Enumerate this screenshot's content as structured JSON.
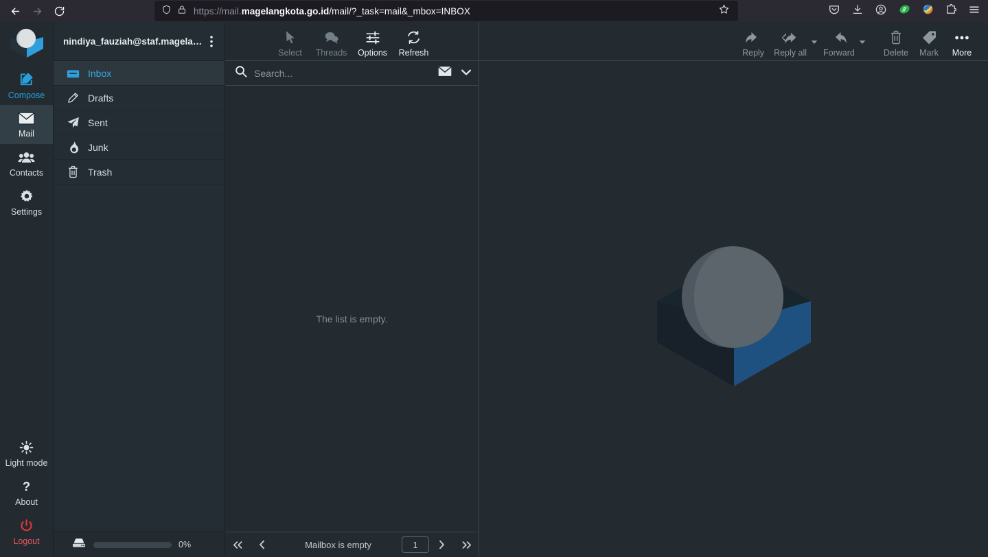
{
  "browser": {
    "back_icon": "back-arrow-icon",
    "forward_icon": "forward-arrow-icon",
    "reload_icon": "reload-icon",
    "shield_icon": "shield-icon",
    "lock_icon": "lock-icon",
    "url_prefix": "https://mail.",
    "url_domain": "magelangkota.go.id",
    "url_path": "/mail/?_task=mail&_mbox=INBOX",
    "url_full": "https://mail.magelangkota.go.id/mail/?_task=mail&_mbox=INBOX",
    "bookmark_icon": "star-icon",
    "toolbar_icons": [
      "pocket-icon",
      "downloads-icon",
      "account-icon",
      "adblock-extension-icon",
      "idm-extension-icon",
      "extensions-puzzle-icon",
      "app-menu-icon"
    ]
  },
  "tasksbar": {
    "logo": "roundcube-logo",
    "top_items": [
      {
        "label": "Compose",
        "icon": "compose-icon",
        "state": "accent"
      },
      {
        "label": "Mail",
        "icon": "mail-icon",
        "state": "active"
      },
      {
        "label": "Contacts",
        "icon": "contacts-icon",
        "state": "normal"
      },
      {
        "label": "Settings",
        "icon": "settings-gear-icon",
        "state": "normal"
      }
    ],
    "bottom_items": [
      {
        "label": "Light mode",
        "icon": "sun-icon",
        "state": "normal"
      },
      {
        "label": "About",
        "icon": "question-mark-icon",
        "state": "normal"
      },
      {
        "label": "Logout",
        "icon": "power-icon",
        "state": "danger"
      }
    ]
  },
  "folders": {
    "account": "nindiya_fauziah@staf.magelan…",
    "options_icon": "vertical-dots-icon",
    "items": [
      {
        "label": "Inbox",
        "icon": "inbox-icon",
        "selected": true
      },
      {
        "label": "Drafts",
        "icon": "pencil-icon",
        "selected": false
      },
      {
        "label": "Sent",
        "icon": "paper-plane-icon",
        "selected": false
      },
      {
        "label": "Junk",
        "icon": "fire-icon",
        "selected": false
      },
      {
        "label": "Trash",
        "icon": "trash-icon",
        "selected": false
      }
    ],
    "quota": {
      "icon": "hard-drive-icon",
      "percent_label": "0%",
      "percent_value": 0
    }
  },
  "list": {
    "toolbar": [
      {
        "label": "Select",
        "icon": "cursor-arrow-icon",
        "disabled": true
      },
      {
        "label": "Threads",
        "icon": "threads-bubbles-icon",
        "disabled": true
      },
      {
        "label": "Options",
        "icon": "sliders-icon",
        "disabled": false
      },
      {
        "label": "Refresh",
        "icon": "refresh-icon",
        "disabled": false
      }
    ],
    "search": {
      "icon": "search-icon",
      "placeholder": "Search...",
      "value": "",
      "scope_icon": "envelope-icon",
      "dropdown_icon": "chevron-down-icon"
    },
    "empty_text": "The list is empty.",
    "footer": {
      "first_icon": "double-chevron-left-icon",
      "prev_icon": "chevron-left-icon",
      "status": "Mailbox is empty",
      "page_value": "1",
      "next_icon": "chevron-right-icon",
      "last_icon": "double-chevron-right-icon"
    }
  },
  "content": {
    "toolbar": [
      {
        "label": "Reply",
        "icon": "reply-icon",
        "enabled": false,
        "caret": false
      },
      {
        "label": "Reply all",
        "icon": "reply-all-icon",
        "enabled": false,
        "caret": true
      },
      {
        "label": "Forward",
        "icon": "forward-icon",
        "enabled": false,
        "caret": true
      },
      {
        "label": "Delete",
        "icon": "trash-icon",
        "enabled": false,
        "caret": false
      },
      {
        "label": "Mark",
        "icon": "tag-icon",
        "enabled": false,
        "caret": false
      },
      {
        "label": "More",
        "icon": "ellipsis-icon",
        "enabled": true,
        "caret": false
      }
    ],
    "watermark_icon": "roundcube-watermark-logo"
  },
  "colors": {
    "accent": "#26a0da",
    "danger": "#e8565c",
    "panel_bg": "#232b30",
    "chrome_bg": "#2b2a33",
    "urlbar_bg": "#1c1b22"
  }
}
